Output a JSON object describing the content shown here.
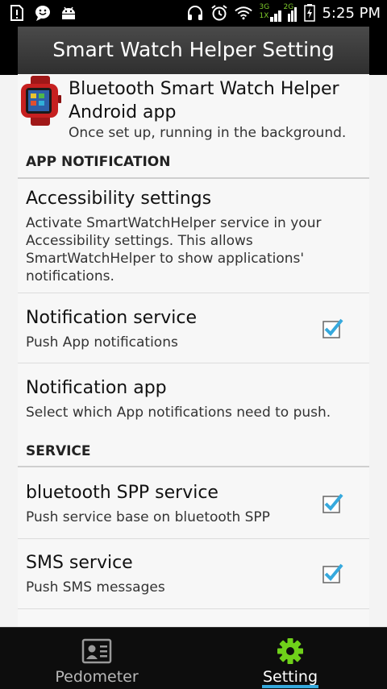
{
  "status_bar": {
    "time": "5:25 PM",
    "network_top": "3G",
    "network_top2": "2G",
    "network_bottom": "1X"
  },
  "header": {
    "title": "Smart Watch Helper Setting"
  },
  "app_info": {
    "title_line1": "Bluetooth Smart Watch Helper",
    "title_line2": "Android app",
    "subtitle": "Once set up, running in the background."
  },
  "sections": {
    "app_notification": "APP NOTIFICATION",
    "service": "SERVICE"
  },
  "items": {
    "accessibility": {
      "title": "Accessibility settings",
      "sub_line1": "Activate SmartWatchHelper service in your",
      "sub_line2": "Accessibility settings. This allows",
      "sub_line3": "SmartWatchHelper to show applications'",
      "sub_line4": "notifications."
    },
    "notification_service": {
      "title": "Notification service",
      "subtitle": "Push App notifications",
      "checked": true
    },
    "notification_app": {
      "title": "Notification app",
      "subtitle": "Select which App notifications need to push."
    },
    "bluetooth_spp": {
      "title": "bluetooth SPP service",
      "subtitle": "Push service base on bluetooth SPP",
      "checked": true
    },
    "sms_service": {
      "title": "SMS service",
      "subtitle": "Push SMS messages",
      "checked": true
    }
  },
  "tabs": {
    "pedometer": "Pedometer",
    "setting": "Setting"
  },
  "colors": {
    "accent": "#36a9dd",
    "setting_icon": "#6fd11a"
  }
}
